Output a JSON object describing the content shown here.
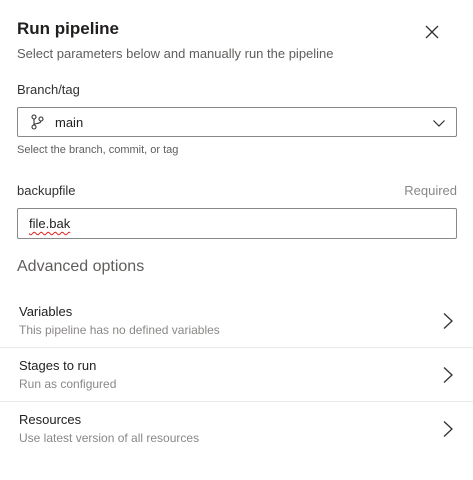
{
  "header": {
    "title": "Run pipeline",
    "subtitle": "Select parameters below and manually run the pipeline",
    "close_icon": "close-icon"
  },
  "branch": {
    "label": "Branch/tag",
    "value": "main",
    "icon": "branch-icon",
    "helper": "Select the branch, commit, or tag"
  },
  "backupfile": {
    "label": "backupfile",
    "required_label": "Required",
    "value": "file.bak",
    "spellcheck_error": true
  },
  "advanced": {
    "heading": "Advanced options",
    "options": [
      {
        "title": "Variables",
        "description": "This pipeline has no defined variables"
      },
      {
        "title": "Stages to run",
        "description": "Run as configured"
      },
      {
        "title": "Resources",
        "description": "Use latest version of all resources"
      }
    ]
  },
  "colors": {
    "text_primary": "#201f1e",
    "text_secondary": "#605e5c",
    "border": "#8a8886",
    "spell_error": "#e0201b"
  }
}
